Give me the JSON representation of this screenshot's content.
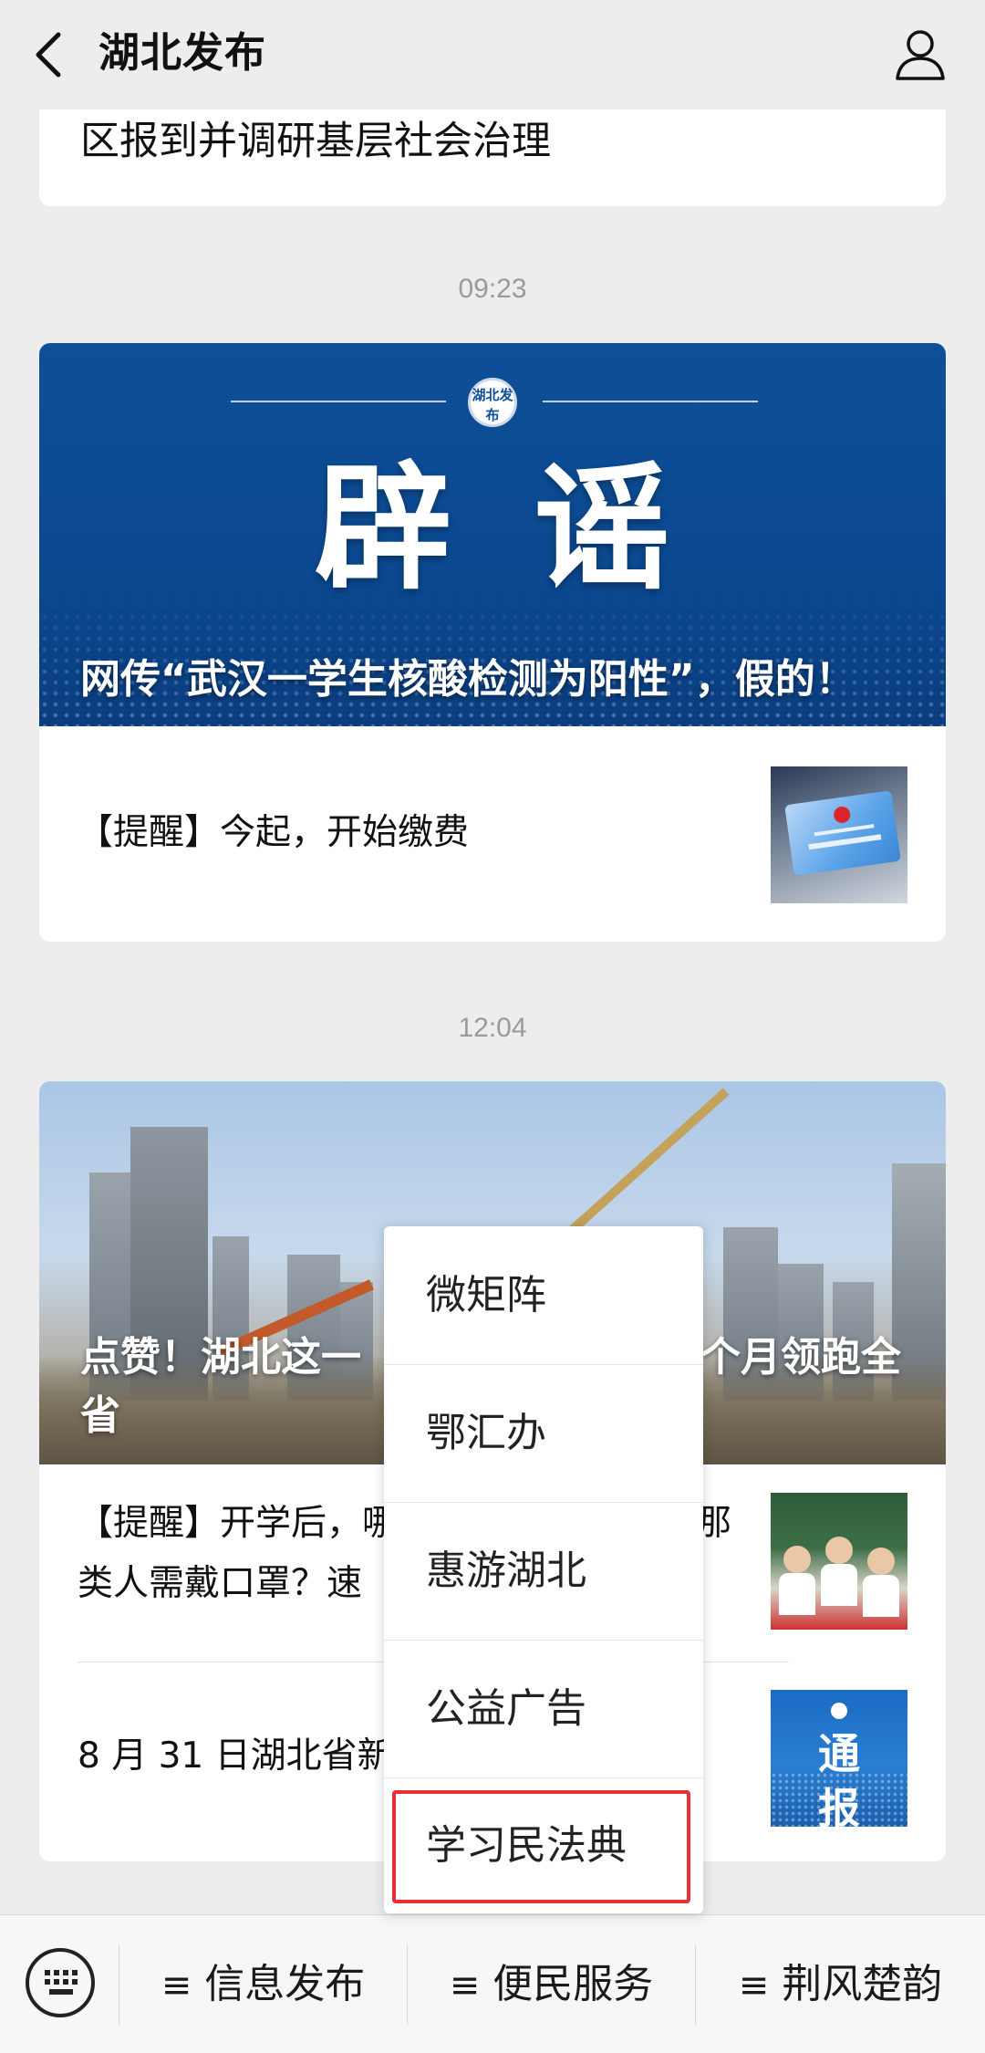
{
  "header": {
    "title": "湖北发布"
  },
  "feed": {
    "top_snippet": "区报到并调研基层社会治理",
    "time1": "09:23",
    "rumor_banner": {
      "logo_text": "湖北发布",
      "big_title": "辟谣",
      "caption": "网传“武汉一学生核酸检测为阳性”，假的！"
    },
    "item1": "【提醒】今起，开始缴费",
    "time2": "12:04",
    "city_banner_caption_line1_left": "点赞！湖北这一",
    "city_banner_caption_line1_right": "个月领跑全",
    "city_banner_caption_line2": "省",
    "item2_line1_left": "【提醒】开学后，哪",
    "item2_line1_right": "那",
    "item2_line2": "类人需戴口罩？速",
    "item3": "8 月 31 日湖北省新",
    "notice_thumb_word": "通报"
  },
  "popup_menu": {
    "items": [
      "微矩阵",
      "鄂汇办",
      "惠游湖北",
      "公益广告",
      "学习民法典"
    ]
  },
  "bottom_bar": {
    "menus": [
      "信息发布",
      "便民服务",
      "荆风楚韵"
    ],
    "hamburger": "≡"
  }
}
